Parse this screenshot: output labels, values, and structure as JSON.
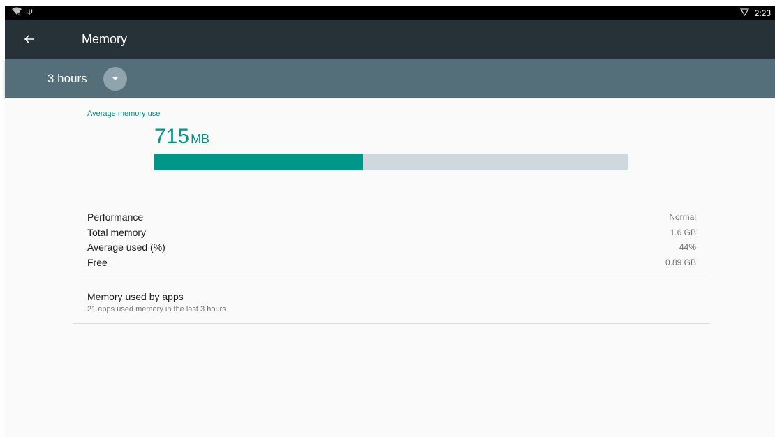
{
  "status_bar": {
    "left_icons": [
      "wifi-question-icon",
      "usb-icon"
    ],
    "signal_icon": "signal-icon",
    "time": "2:23"
  },
  "app_bar": {
    "title": "Memory",
    "back_icon": "arrow-back-icon"
  },
  "range_selector": {
    "value": "3 hours",
    "dropdown_icon": "chevron-down-icon"
  },
  "summary": {
    "label": "Average memory use",
    "value": "715",
    "unit": "MB",
    "usage_fraction": 0.44,
    "colors": {
      "accent": "#009688",
      "track": "#cfd8dc"
    }
  },
  "stats": [
    {
      "label": "Performance",
      "value": "Normal"
    },
    {
      "label": "Total memory",
      "value": "1.6 GB"
    },
    {
      "label": "Average used (%)",
      "value": "44%"
    },
    {
      "label": "Free",
      "value": "0.89 GB"
    }
  ],
  "apps": {
    "title": "Memory used by apps",
    "subtitle": "21 apps used memory in the last 3 hours"
  }
}
